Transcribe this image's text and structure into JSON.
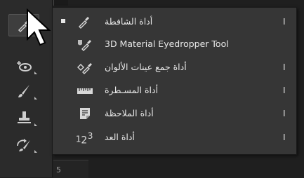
{
  "toolbar": {
    "tools": [
      {
        "icon": "eyedropper-icon"
      },
      {
        "icon": "spot-healing-icon"
      },
      {
        "icon": "brush-icon"
      },
      {
        "icon": "clone-stamp-icon"
      },
      {
        "icon": "history-brush-icon"
      }
    ],
    "ruler_value": "5"
  },
  "flyout": {
    "items": [
      {
        "label": "أداة الشافطة",
        "shortcut": "I",
        "icon": "eyedropper-icon",
        "selected": true
      },
      {
        "label": "3D Material Eyedropper Tool",
        "shortcut": "",
        "icon": "3d-material-eyedropper-icon",
        "selected": false
      },
      {
        "label": "أداة جمع عينات الألوان",
        "shortcut": "I",
        "icon": "color-sampler-icon",
        "selected": false
      },
      {
        "label": "أداة المسـطرة",
        "shortcut": "I",
        "icon": "ruler-icon",
        "selected": false
      },
      {
        "label": "أداة الملاحظة",
        "shortcut": "I",
        "icon": "note-icon",
        "selected": false
      },
      {
        "label": "أداة العد",
        "shortcut": "I",
        "icon": "count-icon",
        "selected": false
      }
    ]
  },
  "colors": {
    "menu_bg": "#363636",
    "toolbar_bg": "#2b2b2b",
    "text": "#e8e8e8"
  }
}
